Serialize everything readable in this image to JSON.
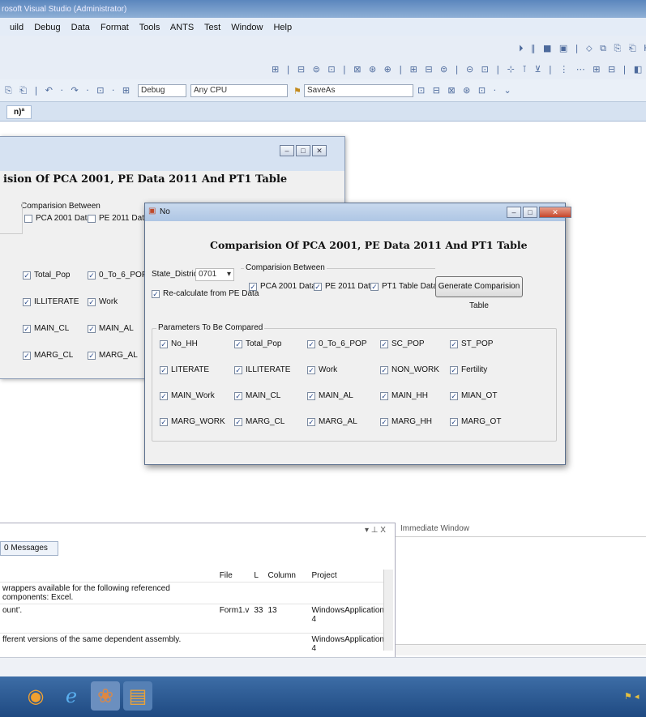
{
  "window": {
    "title": "rosoft Visual Studio (Administrator)"
  },
  "menu": [
    "uild",
    "Debug",
    "Data",
    "Format",
    "Tools",
    "ANTS",
    "Test",
    "Window",
    "Help"
  ],
  "toolbar": {
    "config_value": "Debug",
    "platform_value": "Any CPU",
    "find_value": "SaveAs",
    "icons_row1": "⏵ ‖ ■ ▣ | ⬦ ⧉ ⎘ ⎗ H",
    "icons_row2": "⊞ | ⊟ ⊜ ⊡ | ⊠ ⊛ ⊕ | ⊞ ⊟ ⊜ | ⊝ ⊡ | ⊹ ⊺ ⊻ | ⋮ ⋯ ⊞ ⊟ | ◧ ◨ ▤",
    "icons_row3": "⎘ ⎗ | ↶ · ↷ · ⊡ · ⊞ | ⏵",
    "icons_row4": "⊡ ⊟ ⊠ ⊛ ⊡ · ⌄"
  },
  "document_tab": {
    "label": "n)ª"
  },
  "back_form": {
    "title": "ision Of PCA 2001, PE Data 2011 And PT1 Table",
    "compare_label": "Comparision Between",
    "compare_items": [
      "PCA 2001 Data",
      "PE 2011 Data"
    ],
    "params_col1": [
      "Total_Pop",
      "ILLITERATE",
      "MAIN_CL",
      "MARG_CL"
    ],
    "params_col2": [
      "0_To_6_POP",
      "Work",
      "MAIN_AL",
      "MARG_AL"
    ]
  },
  "dialog": {
    "title_text": "No",
    "heading": "Comparision Of PCA 2001, PE Data 2011 And PT1 Table",
    "state_label": "State_District",
    "state_value": "0701",
    "recalc_label": "Re-calculate from PE Data",
    "compare_label": "Comparision Between",
    "compare_items": [
      "PCA 2001 Data",
      "PE 2011 Data",
      "PT1 Table Data"
    ],
    "generate_button": "Generate Comparision Table",
    "params_label": "Parameters To Be Compared",
    "params": [
      [
        "No_HH",
        "Total_Pop",
        "0_To_6_POP",
        "SC_POP",
        "ST_POP"
      ],
      [
        "LITERATE",
        "ILLITERATE",
        "Work",
        "NON_WORK",
        "Fertility"
      ],
      [
        "MAIN_Work",
        "MAIN_CL",
        "MAIN_AL",
        "MAIN_HH",
        "MIAN_OT"
      ],
      [
        "MARG_WORK",
        "MARG_CL",
        "MARG_AL",
        "MARG_HH",
        "MARG_OT"
      ]
    ]
  },
  "error_list": {
    "pane_controls": "▾ ⊥ X",
    "messages_tab": "0 Messages",
    "columns": {
      "file": "File",
      "line": "L",
      "column": "Column",
      "project": "Project"
    },
    "rows": [
      {
        "desc": "wrappers available for the following referenced components: Excel.",
        "file": "",
        "line": "",
        "column": "",
        "project": ""
      },
      {
        "desc": "ount'.",
        "file": "Form1.v",
        "line": "33",
        "column": "13",
        "project": "WindowsApplication 4"
      },
      {
        "desc": "fferent versions of the same dependent assembly.",
        "file": "",
        "line": "",
        "column": "",
        "project": "WindowsApplication 4"
      }
    ]
  },
  "immediate": {
    "title": "Immediate Window"
  },
  "colors": {
    "accent": "#3d6da6",
    "checkmark": "#2c4c8c",
    "close": "#c6452a"
  }
}
